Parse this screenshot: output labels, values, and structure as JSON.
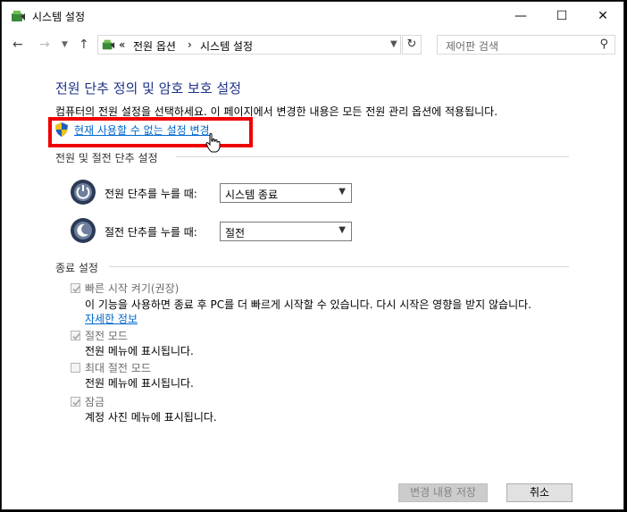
{
  "window": {
    "title": "시스템 설정",
    "minimize": "—",
    "maximize": "☐",
    "close": "✕"
  },
  "nav": {
    "back": "←",
    "forward": "→",
    "recent": "▼",
    "up": "↑",
    "prefix": "«",
    "breadcrumbs": [
      "전원 옵션",
      "시스템 설정"
    ],
    "separator": "›",
    "dropdown": "▼",
    "refresh": "↻",
    "search_placeholder": "제어판 검색",
    "search_icon": "⚲"
  },
  "main": {
    "heading": "전원 단추 정의 및 암호 보호 설정",
    "description": "컴퓨터의 전원 설정을 선택하세요. 이 페이지에서 변경한 내용은 모든 전원 관리 옵션에 적용됩니다.",
    "change_link": "현재 사용할 수 없는 설정 변경",
    "buttons_section": "전원 및 절전 단추 설정",
    "power_button_label": "전원 단추를 누를 때:",
    "power_button_value": "시스템 종료",
    "sleep_button_label": "절전 단추를 누를 때:",
    "sleep_button_value": "절전",
    "shutdown_section": "종료 설정",
    "options": [
      {
        "label": "빠른 시작 켜기(권장)",
        "checked": true,
        "desc": "이 기능을 사용하면 종료 후 PC를 더 빠르게 시작할 수 있습니다. 다시 시작은 영향을 받지 않습니다.",
        "link": "자세한 정보"
      },
      {
        "label": "절전 모드",
        "checked": true,
        "desc": "전원 메뉴에 표시됩니다."
      },
      {
        "label": "최대 절전 모드",
        "checked": false,
        "desc": "전원 메뉴에 표시됩니다."
      },
      {
        "label": "잠금",
        "checked": true,
        "desc": "계정 사진 메뉴에 표시됩니다."
      }
    ]
  },
  "footer": {
    "save": "변경 내용 저장",
    "cancel": "취소"
  },
  "colors": {
    "heading": "#1e3287",
    "link": "#0066cc",
    "highlight": "#e00000"
  }
}
